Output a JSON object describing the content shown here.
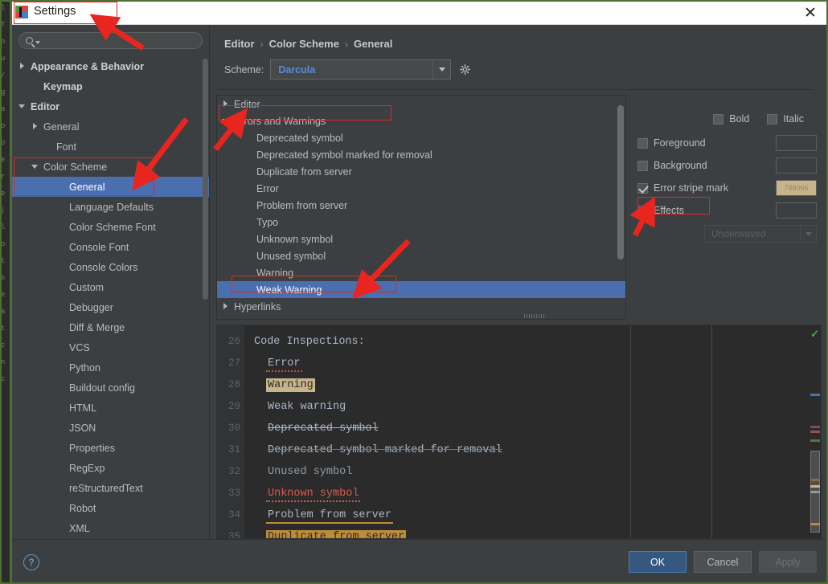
{
  "window": {
    "title": "Settings",
    "close_label": "✕",
    "app_icon": "pycharm-icon"
  },
  "search": {
    "value": "",
    "placeholder": "",
    "icon": "search-icon"
  },
  "sidebar": {
    "items": [
      {
        "label": "Appearance & Behavior",
        "indent": 0,
        "twisty": "closed",
        "bold": true,
        "selected": false
      },
      {
        "label": "Keymap",
        "indent": 1,
        "twisty": "none",
        "bold": true,
        "selected": false
      },
      {
        "label": "Editor",
        "indent": 0,
        "twisty": "open",
        "bold": true,
        "selected": false
      },
      {
        "label": "General",
        "indent": 1,
        "twisty": "closed",
        "bold": false,
        "selected": false
      },
      {
        "label": "Font",
        "indent": 2,
        "twisty": "none",
        "bold": false,
        "selected": false
      },
      {
        "label": "Color Scheme",
        "indent": 1,
        "twisty": "open",
        "bold": false,
        "selected": false
      },
      {
        "label": "General",
        "indent": 3,
        "twisty": "none",
        "bold": false,
        "selected": true
      },
      {
        "label": "Language Defaults",
        "indent": 3,
        "twisty": "none",
        "bold": false,
        "selected": false
      },
      {
        "label": "Color Scheme Font",
        "indent": 3,
        "twisty": "none",
        "bold": false,
        "selected": false
      },
      {
        "label": "Console Font",
        "indent": 3,
        "twisty": "none",
        "bold": false,
        "selected": false
      },
      {
        "label": "Console Colors",
        "indent": 3,
        "twisty": "none",
        "bold": false,
        "selected": false
      },
      {
        "label": "Custom",
        "indent": 3,
        "twisty": "none",
        "bold": false,
        "selected": false
      },
      {
        "label": "Debugger",
        "indent": 3,
        "twisty": "none",
        "bold": false,
        "selected": false
      },
      {
        "label": "Diff & Merge",
        "indent": 3,
        "twisty": "none",
        "bold": false,
        "selected": false
      },
      {
        "label": "VCS",
        "indent": 3,
        "twisty": "none",
        "bold": false,
        "selected": false
      },
      {
        "label": "Python",
        "indent": 3,
        "twisty": "none",
        "bold": false,
        "selected": false
      },
      {
        "label": "Buildout config",
        "indent": 3,
        "twisty": "none",
        "bold": false,
        "selected": false
      },
      {
        "label": "HTML",
        "indent": 3,
        "twisty": "none",
        "bold": false,
        "selected": false
      },
      {
        "label": "JSON",
        "indent": 3,
        "twisty": "none",
        "bold": false,
        "selected": false
      },
      {
        "label": "Properties",
        "indent": 3,
        "twisty": "none",
        "bold": false,
        "selected": false
      },
      {
        "label": "RegExp",
        "indent": 3,
        "twisty": "none",
        "bold": false,
        "selected": false
      },
      {
        "label": "reStructuredText",
        "indent": 3,
        "twisty": "none",
        "bold": false,
        "selected": false
      },
      {
        "label": "Robot",
        "indent": 3,
        "twisty": "none",
        "bold": false,
        "selected": false
      },
      {
        "label": "XML",
        "indent": 3,
        "twisty": "none",
        "bold": false,
        "selected": false
      }
    ]
  },
  "breadcrumb": {
    "items": [
      "Editor",
      "Color Scheme",
      "General"
    ],
    "separator": "›"
  },
  "scheme": {
    "label": "Scheme:",
    "value": "Darcula",
    "gear_icon": "gear-icon",
    "dropdown_icon": "chevron-down-icon"
  },
  "color_tree": {
    "nodes": [
      {
        "label": "Editor",
        "indent": 0,
        "twisty": "closed",
        "selected": false
      },
      {
        "label": "Errors and Warnings",
        "indent": 0,
        "twisty": "open",
        "selected": false
      },
      {
        "label": "Deprecated symbol",
        "indent": 1,
        "twisty": "none",
        "selected": false
      },
      {
        "label": "Deprecated symbol marked for removal",
        "indent": 1,
        "twisty": "none",
        "selected": false
      },
      {
        "label": "Duplicate from server",
        "indent": 1,
        "twisty": "none",
        "selected": false
      },
      {
        "label": "Error",
        "indent": 1,
        "twisty": "none",
        "selected": false
      },
      {
        "label": "Problem from server",
        "indent": 1,
        "twisty": "none",
        "selected": false
      },
      {
        "label": "Typo",
        "indent": 1,
        "twisty": "none",
        "selected": false
      },
      {
        "label": "Unknown symbol",
        "indent": 1,
        "twisty": "none",
        "selected": false
      },
      {
        "label": "Unused symbol",
        "indent": 1,
        "twisty": "none",
        "selected": false
      },
      {
        "label": "Warning",
        "indent": 1,
        "twisty": "none",
        "selected": false
      },
      {
        "label": "Weak Warning",
        "indent": 1,
        "twisty": "none",
        "selected": true
      },
      {
        "label": "Hyperlinks",
        "indent": 0,
        "twisty": "closed",
        "selected": false
      }
    ]
  },
  "attributes": {
    "bold": {
      "label": "Bold",
      "checked": false
    },
    "italic": {
      "label": "Italic",
      "checked": false
    },
    "rows": [
      {
        "label": "Foreground",
        "checked": false,
        "swatch": "",
        "swatch_filled": false
      },
      {
        "label": "Background",
        "checked": false,
        "swatch": "",
        "swatch_filled": false
      },
      {
        "label": "Error stripe mark",
        "checked": true,
        "swatch": "788066",
        "swatch_filled": true
      },
      {
        "label": "Effects",
        "checked": false,
        "swatch": "",
        "swatch_filled": false
      }
    ],
    "effect_type": {
      "value": "Underwaved",
      "enabled": false
    }
  },
  "preview": {
    "lines": [
      {
        "num": "26",
        "text": "Code Inspections:",
        "indent": false,
        "style": "plain"
      },
      {
        "num": "27",
        "text": "Error",
        "indent": true,
        "style": "error"
      },
      {
        "num": "28",
        "text": "Warning",
        "indent": true,
        "style": "warning"
      },
      {
        "num": "29",
        "text": "Weak warning",
        "indent": true,
        "style": "weak"
      },
      {
        "num": "30",
        "text": "Deprecated symbol",
        "indent": true,
        "style": "deprecated"
      },
      {
        "num": "31",
        "text": "Deprecated symbol marked for removal",
        "indent": true,
        "style": "deprecated-removal"
      },
      {
        "num": "32",
        "text": "Unused symbol",
        "indent": true,
        "style": "unused"
      },
      {
        "num": "33",
        "text": "Unknown symbol",
        "indent": true,
        "style": "unknown"
      },
      {
        "num": "34",
        "text": "Problem from server",
        "indent": true,
        "style": "problem-server"
      },
      {
        "num": "35",
        "text": "Duplicate from server",
        "indent": true,
        "style": "duplicate-server"
      }
    ],
    "inspection_ok_icon": "checkmark-icon"
  },
  "footer": {
    "help_label": "?",
    "ok": "OK",
    "cancel": "Cancel",
    "apply": "Apply"
  },
  "colors": {
    "dialog_bg": "#3c3f41",
    "selection_blue": "#4b6eaf",
    "accent_link": "#5c8ad6",
    "annotation_red": "#e8251f",
    "error_stripe_swatch": "#c8b48a",
    "editor_bg": "#2b2b2b",
    "error_red": "#bc3f3c",
    "warning_tan": "#c8b48a",
    "unknown_red": "#d55a50",
    "server_orange": "#bd8c3a"
  },
  "background_sliver": {
    "chars": [
      "l",
      "T",
      "o",
      "u",
      "/",
      "g",
      "a",
      "o",
      "o",
      "e",
      "r",
      "e",
      "|",
      "l",
      "o",
      "t",
      "s",
      "e",
      "a",
      "t",
      "c",
      "n",
      "c"
    ]
  }
}
